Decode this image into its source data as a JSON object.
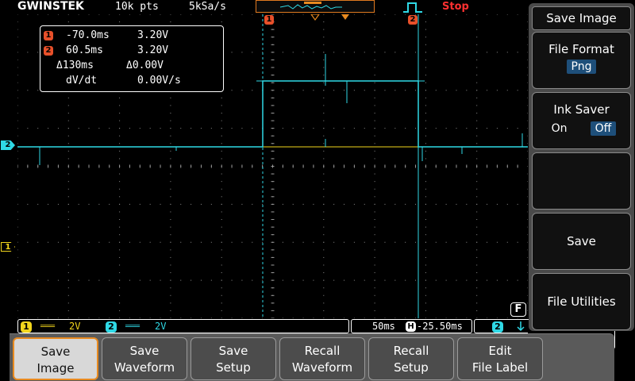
{
  "brand": "GWINSTEK",
  "status": {
    "record_length": "10k pts",
    "sample_rate": "5kSa/s",
    "run_state": "Stop"
  },
  "cursor_readout": {
    "c1": {
      "badge": "1",
      "time": "-70.0ms",
      "volt": "3.20V"
    },
    "c2": {
      "badge": "2",
      "time": "60.5ms",
      "volt": "3.20V"
    },
    "delta": {
      "time": "Δ130ms",
      "volt": "Δ0.00V"
    },
    "dvdt": {
      "label": "dV/dt",
      "value": "0.00V/s"
    }
  },
  "cursor_markers": {
    "c1": "1",
    "c2": "2"
  },
  "channel_markers": {
    "ch1": "1",
    "ch2": "2"
  },
  "bottom_bar": {
    "ch1": {
      "badge": "1",
      "coupling": "═══",
      "scale": "2V"
    },
    "ch2": {
      "badge": "2",
      "coupling": "═══",
      "scale": "2V"
    },
    "timebase": "50ms",
    "h_badge": "H",
    "position": "-25.50ms",
    "trig_src": "2",
    "trig_slope_icon": "falling-edge-icon"
  },
  "f_badge": "F",
  "menu": {
    "title": "Save Image",
    "file_format": {
      "label": "File Format",
      "value": "Png"
    },
    "ink_saver": {
      "label": "Ink Saver",
      "on": "On",
      "off": "Off",
      "selected": "Off"
    },
    "save": "Save",
    "file_utilities": "File Utilities"
  },
  "softkeys": [
    {
      "line1": "Save",
      "line2": "Image",
      "active": true
    },
    {
      "line1": "Save",
      "line2": "Waveform",
      "active": false
    },
    {
      "line1": "Save",
      "line2": "Setup",
      "active": false
    },
    {
      "line1": "Recall",
      "line2": "Waveform",
      "active": false
    },
    {
      "line1": "Recall",
      "line2": "Setup",
      "active": false
    },
    {
      "line1": "Edit",
      "line2": "File Label",
      "active": false
    }
  ],
  "colors": {
    "ch1": "#f2d61c",
    "ch2": "#2fd9e6",
    "cursor": "#e8502a",
    "accent": "#e88a20",
    "selected": "#1e4f7a"
  }
}
